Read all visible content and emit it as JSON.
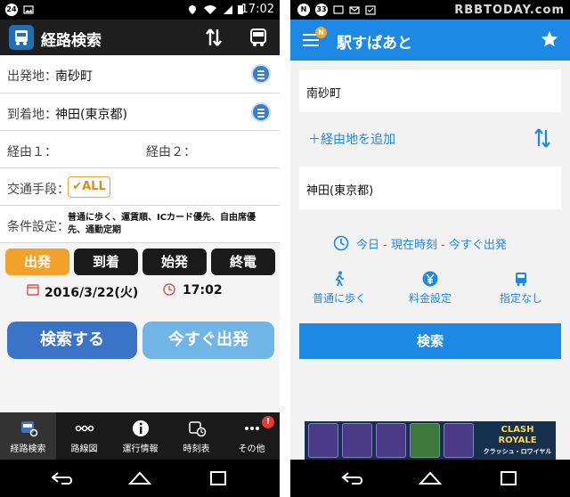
{
  "left": {
    "statusbar": {
      "badge": "24",
      "time": "17:02"
    },
    "header": {
      "title": "経路検索"
    },
    "form": {
      "from_label": "出発地：",
      "from_value": "南砂町",
      "to_label": "到着地：",
      "to_value": "神田(東京都)",
      "via1_label": "経由１：",
      "via2_label": "経由２：",
      "transport_label": "交通手段：",
      "transport_value": "ALL",
      "conditions_label": "条件設定：",
      "conditions_value": "普通に歩く、運賃順、ICカード優先、自由席優先、通勤定期"
    },
    "segments": [
      {
        "label": "出発",
        "active": true
      },
      {
        "label": "到着",
        "active": false
      },
      {
        "label": "始発",
        "active": false
      },
      {
        "label": "終電",
        "active": false
      }
    ],
    "date": "2016/3/22(火)",
    "time": "17:02",
    "search_button": "検索する",
    "now_button": "今すぐ出発",
    "bottom_nav": [
      {
        "label": "経路検索",
        "icon": "bus-search-icon",
        "active": true
      },
      {
        "label": "路線図",
        "icon": "route-map-icon",
        "active": false
      },
      {
        "label": "運行情報",
        "icon": "info-icon",
        "active": false
      },
      {
        "label": "時刻表",
        "icon": "timetable-icon",
        "active": false
      },
      {
        "label": "その他",
        "icon": "more-icon",
        "active": false,
        "badge": "!"
      }
    ]
  },
  "right": {
    "statusbar": {
      "badge1": "N",
      "badge2": "33"
    },
    "watermark": "RBBTODAY.com",
    "header": {
      "title": "駅すぱあと",
      "menu_badge": "N"
    },
    "from_value": "南砂町",
    "add_via": "＋経由地を追加",
    "to_value": "神田(東京都)",
    "when": "今日 - 現在時刻 - 今すぐ出発",
    "options": [
      {
        "label": "普通に歩く",
        "icon": "walk-icon"
      },
      {
        "label": "料金設定",
        "icon": "yen-icon"
      },
      {
        "label": "指定なし",
        "icon": "bus-icon"
      }
    ],
    "search_button": "検索",
    "ad": {
      "title_line1": "CLASH",
      "title_line2": "ROYALE",
      "subtitle": "クラッシュ・ロワイヤル"
    }
  },
  "colors": {
    "left_accent": "#f2a22a",
    "left_search": "#3b74c6",
    "left_now": "#6fb5e6",
    "right_primary": "#1e88e5"
  }
}
